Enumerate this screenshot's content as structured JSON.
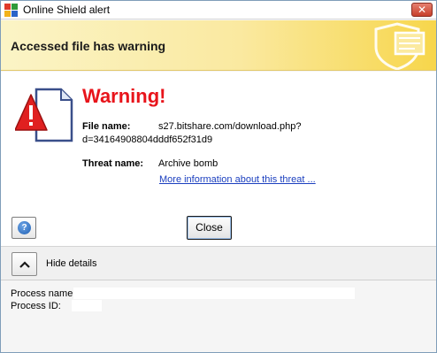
{
  "window": {
    "title": "Online Shield alert",
    "close_glyph": "✕"
  },
  "banner": {
    "title": "Accessed file has warning"
  },
  "alert": {
    "heading": "Warning!",
    "file_name_label": "File name:",
    "file_name_line1": "s27.bitshare.com/download.php?",
    "file_name_line2": "d=34164908804dddf652f31d9",
    "threat_name_label": "Threat name:",
    "threat_name_value": "Archive bomb",
    "more_info_link": "More information about this threat ..."
  },
  "buttons": {
    "help_glyph": "?",
    "close_label": "Close"
  },
  "details": {
    "toggle_label": "Hide details",
    "process_name_label": "Process name:",
    "process_id_label": "Process ID:"
  },
  "colors": {
    "warning_red": "#e8141b",
    "link_blue": "#1b3fbf",
    "banner_yellow": "#f7d64b"
  }
}
